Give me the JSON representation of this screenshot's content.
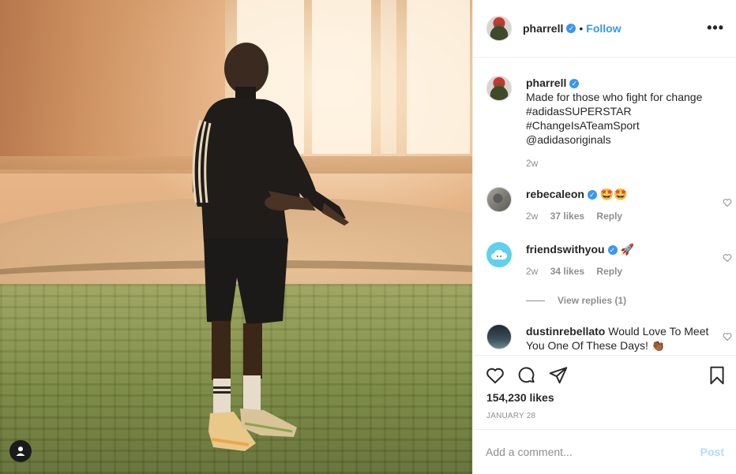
{
  "post": {
    "username": "pharrell",
    "follow_label": "Follow",
    "separator": "•",
    "more_icon": "more-horizontal-icon",
    "caption_lines": [
      "Made for those who fight for change",
      "#adidasSUPERSTAR",
      "#ChangeIsATeamSport",
      "@adidasoriginals"
    ],
    "caption_time": "2w",
    "likes": "154,230 likes",
    "date": "JANUARY 28"
  },
  "comments": [
    {
      "username": "rebecaleon",
      "text": "🤩🤩",
      "time": "2w",
      "likes": "37 likes",
      "reply": "Reply"
    },
    {
      "username": "friendswithyou",
      "text": "🚀",
      "time": "2w",
      "likes": "34 likes",
      "reply": "Reply"
    },
    {
      "username": "dustinrebellato",
      "text": "Would Love To Meet You One Of These Days! 👏🏾"
    }
  ],
  "view_replies": "View replies (1)",
  "add_comment": {
    "placeholder": "Add a comment...",
    "post_label": "Post"
  },
  "colors": {
    "link_blue": "#3897f0",
    "post_disabled": "#b3dbff",
    "meta_grey": "#8e8e8e"
  },
  "icons": [
    "heart-icon",
    "comment-icon",
    "share-icon",
    "bookmark-icon",
    "verified-badge-icon",
    "user-tag-icon"
  ]
}
